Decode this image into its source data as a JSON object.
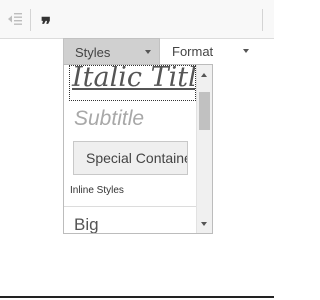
{
  "toolbar": {
    "icons": [
      "outdent-icon",
      "blockquote-icon"
    ],
    "blockquote_glyph": "❞",
    "styles_label": "Styles",
    "format_label": "Format"
  },
  "styles_menu": {
    "items": [
      {
        "label": "Italic Title",
        "state": "focused"
      },
      {
        "label": "Subtitle"
      },
      {
        "label": "Special Container"
      }
    ],
    "section_heading": "Inline Styles",
    "inline_items": [
      {
        "label": "Big"
      }
    ]
  },
  "colors": {
    "toolbar_bg": "#f8f8f8",
    "active_combo_bg": "#d0d0d0",
    "scroll_thumb": "#c1c1c1"
  }
}
